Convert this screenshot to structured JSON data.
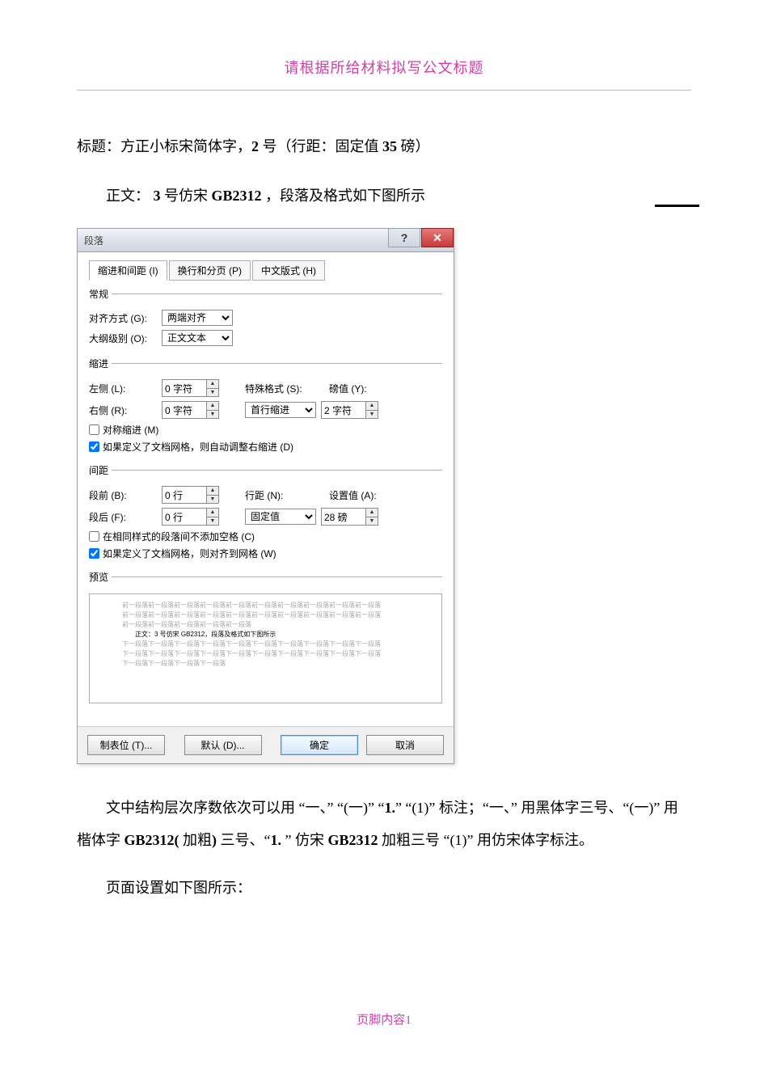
{
  "header_text": "请根据所给材料拟写公文标题",
  "line1_prefix": "标题：方正小标宋简体字，",
  "line1_bold1": "2",
  "line1_mid": " 号（行距：固定值 ",
  "line1_bold2": "35",
  "line1_suffix": " 磅）",
  "line2_prefix": "正文： ",
  "line2_bold1": "3",
  "line2_mid1": " 号仿宋 ",
  "line2_bold2": "GB2312",
  "line2_suffix": " ，段落及格式如下图所示",
  "dialog": {
    "title": "段落",
    "tabs": {
      "t1": "缩进和间距 (I)",
      "t2": "换行和分页 (P)",
      "t3": "中文版式 (H)"
    },
    "group_general": "常规",
    "align_label": "对齐方式 (G):",
    "align_value": "两端对齐",
    "outline_label": "大纲级别 (O):",
    "outline_value": "正文文本",
    "group_indent": "缩进",
    "left_label": "左侧 (L):",
    "left_value": "0 字符",
    "right_label": "右侧 (R):",
    "right_value": "0 字符",
    "special_label": "特殊格式 (S):",
    "special_value": "首行缩进",
    "by_label": "磅值 (Y):",
    "by_value": "2 字符",
    "mirror_label": "对称缩进 (M)",
    "auto_adjust_label": "如果定义了文档网格，则自动调整右缩进 (D)",
    "group_spacing": "间距",
    "before_label": "段前 (B):",
    "before_value": "0 行",
    "after_label": "段后 (F):",
    "after_value": "0 行",
    "linespace_label": "行距 (N):",
    "linespace_value": "固定值",
    "at_label": "设置值 (A):",
    "at_value": "28 磅",
    "nospace_label": "在相同样式的段落间不添加空格 (C)",
    "snapgrid_label": "如果定义了文档网格，则对齐到网格 (W)",
    "group_preview": "预览",
    "preview_grey1": "前一段落前一段落前一段落前一段落前一段落前一段落前一段落前一段落前一段落前一段落",
    "preview_grey2": "前一段落前一段落前一段落前一段落前一段落前一段落前一段落前一段落前一段落前一段落",
    "preview_grey3": "前一段落前一段落前一段落前一段落前一段落",
    "preview_bold": "正文：3 号仿宋 GB2312，段落及格式如下图所示",
    "preview_grey4": "下一段落下一段落下一段落下一段落下一段落下一段落下一段落下一段落下一段落下一段落",
    "preview_grey5": "下一段落下一段落下一段落下一段落下一段落下一段落下一段落下一段落下一段落下一段落",
    "preview_grey6": "下一段落下一段落下一段落下一段落",
    "btn_tabs": "制表位 (T)...",
    "btn_default": "默认 (D)...",
    "btn_ok": "确定",
    "btn_cancel": "取消"
  },
  "para_seq1": "文中结构层次序数依次可以用 “一、” “(一)” “",
  "para_seq_b1": "1.",
  "para_seq2": "” “(1)” 标注；“一、” 用黑体字三号、“(一)” 用楷体字 ",
  "para_seq_b2": "GB2312(",
  "para_seq3": " 加粗",
  "para_seq_b3": ")",
  "para_seq4": " 三号、“",
  "para_seq_b4": "1.",
  "para_seq5": " ” 仿宋 ",
  "para_seq_b5": "GB2312",
  "para_seq6": "  加粗三号  “(1)” 用仿宋体字标注。",
  "para_last": "页面设置如下图所示：",
  "footer": "页脚内容1"
}
